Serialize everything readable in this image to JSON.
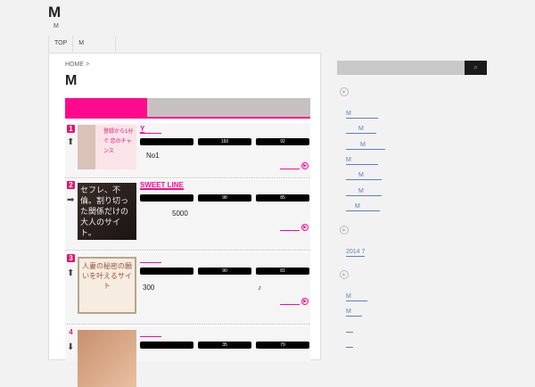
{
  "header": {
    "title": "M",
    "description": "M"
  },
  "nav": [
    "TOP",
    "M"
  ],
  "breadcrumb": "HOME >",
  "page_title": "M",
  "items": [
    {
      "rank": "1",
      "trend": "up",
      "name": "Y",
      "stats": [
        "",
        "150",
        "92"
      ],
      "desc": "No1",
      "thumb": "登録から1分で 恋のチャンス"
    },
    {
      "rank": "2",
      "trend": "right",
      "name": "SWEET LINE",
      "stats": [
        "",
        "98",
        "85"
      ],
      "desc": "5000",
      "thumb": "セフレ、不倫。割り切った関係だけの大人のサイト。"
    },
    {
      "rank": "3",
      "trend": "up",
      "name": "",
      "stats": [
        "",
        "90",
        "81"
      ],
      "desc": "300",
      "desc2": "♪",
      "thumb": "人妻の秘密の願いを叶えるサイト"
    },
    {
      "rank": "4",
      "trend": "down",
      "name": "",
      "stats": [
        "",
        "35",
        "79"
      ],
      "thumb": ""
    }
  ],
  "sidebar": {
    "search_placeholder": "",
    "links1": [
      "M",
      "M",
      "M",
      "M",
      "M",
      "M",
      "M"
    ],
    "archive": [
      "2014 7"
    ],
    "links2": [
      "M",
      "M",
      "",
      ""
    ]
  },
  "colors": {
    "accent": "#ff0a8c",
    "link": "#5a7fc4"
  }
}
